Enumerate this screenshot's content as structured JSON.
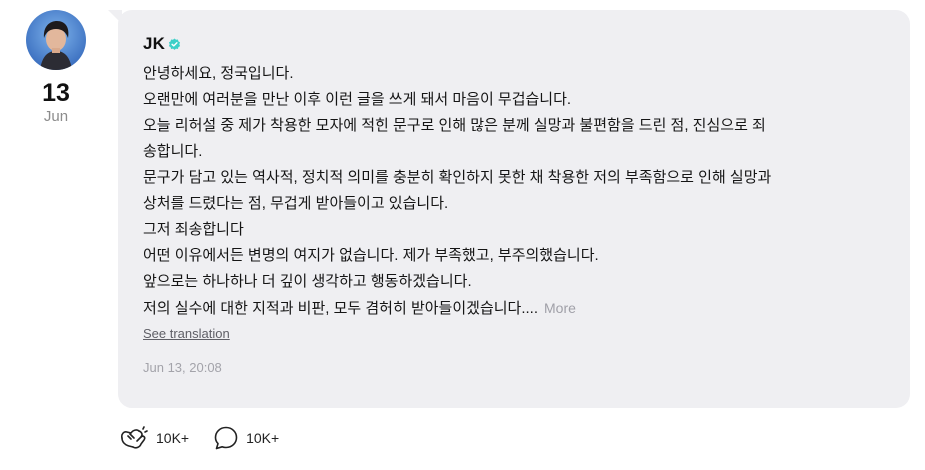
{
  "post": {
    "date_day": "13",
    "date_month": "Jun",
    "author": "JK",
    "verified_icon": "verified-badge-icon",
    "verified_color": "#3dd0c8",
    "lines": [
      "안녕하세요, 정국입니다.",
      "오랜만에 여러분을 만난 이후 이런 글을 쓰게 돼서 마음이 무겁습니다.",
      "오늘 리허설 중 제가 착용한 모자에 적힌 문구로 인해 많은 분께 실망과 불편함을 드린 점, 진심으로 죄",
      "송합니다.",
      "문구가 담고 있는 역사적, 정치적 의미를 충분히 확인하지 못한 채 착용한 저의 부족함으로 인해 실망과",
      "상처를 드렸다는 점, 무겁게 받아들이고 있습니다.",
      "그저 죄송합니다",
      "어떤 이유에서든 변명의 여지가 없습니다. 제가 부족했고, 부주의했습니다.",
      "앞으로는 하나하나 더 깊이 생각하고 행동하겠습니다.",
      "저의 실수에 대한 지적과 비판, 모두 겸허히 받아들이겠습니다...."
    ],
    "more_label": "More",
    "see_translation_label": "See translation",
    "timestamp": "Jun 13, 20:08",
    "bubble_color": "#efeff2"
  },
  "actions": {
    "like_icon": "like-hands-icon",
    "like_count": "10K+",
    "comment_icon": "comment-bubble-icon",
    "comment_count": "10K+"
  }
}
